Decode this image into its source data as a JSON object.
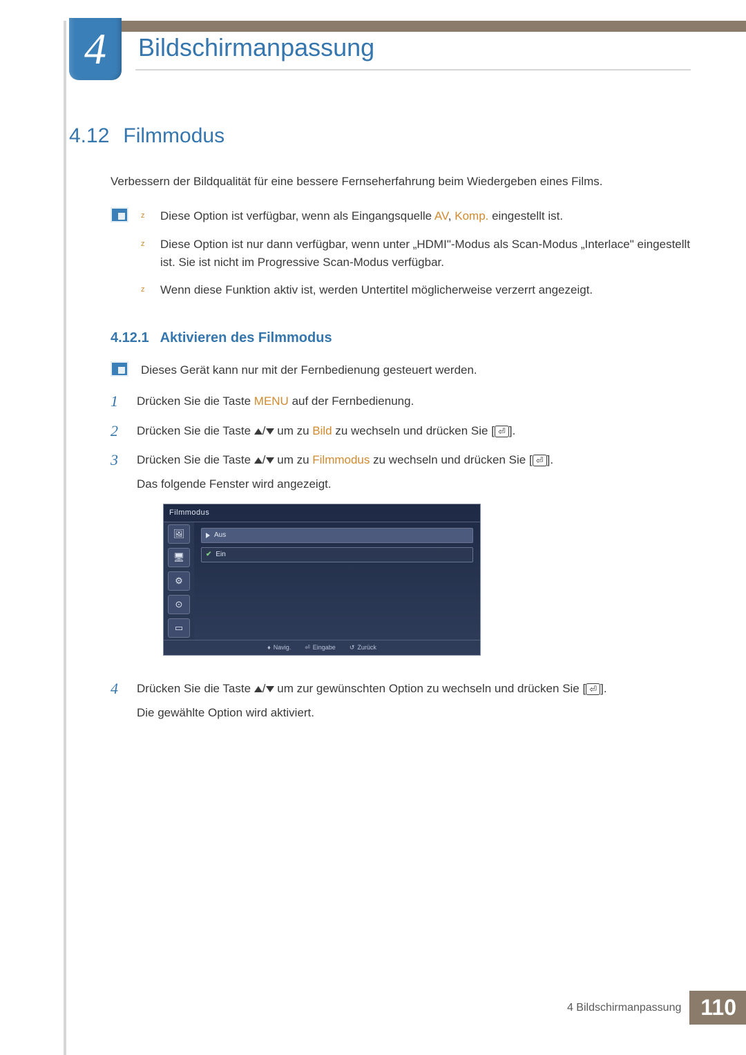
{
  "chapter": {
    "number": "4",
    "title": "Bildschirmanpassung"
  },
  "section": {
    "number": "4.12",
    "title": "Filmmodus"
  },
  "intro": "Verbessern der Bildqualität für eine bessere Fernseherfahrung beim Wiedergeben eines Films.",
  "notes": {
    "n1a": "Diese Option ist verfügbar, wenn als Eingangsquelle ",
    "n1kw1": "AV",
    "n1mid": ", ",
    "n1kw2": "Komp.",
    "n1b": " eingestellt ist.",
    "n2": "Diese Option ist nur dann verfügbar, wenn unter „HDMI\"-Modus als Scan-Modus „Interlace\" eingestellt ist. Sie ist nicht im Progressive Scan-Modus verfügbar.",
    "n3": "Wenn diese Funktion aktiv ist, werden Untertitel möglicherweise verzerrt angezeigt."
  },
  "subsection": {
    "number": "4.12.1",
    "title": "Aktivieren des Filmmodus"
  },
  "remote_note": "Dieses Gerät kann nur mit der Fernbedienung gesteuert werden.",
  "steps": {
    "s1a": "Drücken Sie die Taste ",
    "s1kw": "MENU",
    "s1b": " auf der Fernbedienung.",
    "s2a": "Drücken Sie die Taste ",
    "s2mid": " um zu ",
    "s2kw": "Bild",
    "s2b": " zu wechseln und drücken Sie [",
    "s2c": "].",
    "s3a": "Drücken Sie die Taste ",
    "s3mid": " um zu ",
    "s3kw": "Filmmodus",
    "s3b": " zu wechseln und drücken Sie [",
    "s3c": "].",
    "s3d": "Das folgende Fenster wird angezeigt.",
    "s4a": "Drücken Sie die Taste ",
    "s4mid": " um zur gewünschten Option zu wechseln und drücken Sie [",
    "s4b": "].",
    "s4c": "Die gewählte Option wird aktiviert."
  },
  "osd": {
    "title": "Filmmodus",
    "opt1": "Aus",
    "opt2": "Ein",
    "foot_move": "Navig.",
    "foot_enter": "Eingabe",
    "foot_return": "Zurück"
  },
  "footer": {
    "label": "4 Bildschirmanpassung",
    "page": "110"
  }
}
